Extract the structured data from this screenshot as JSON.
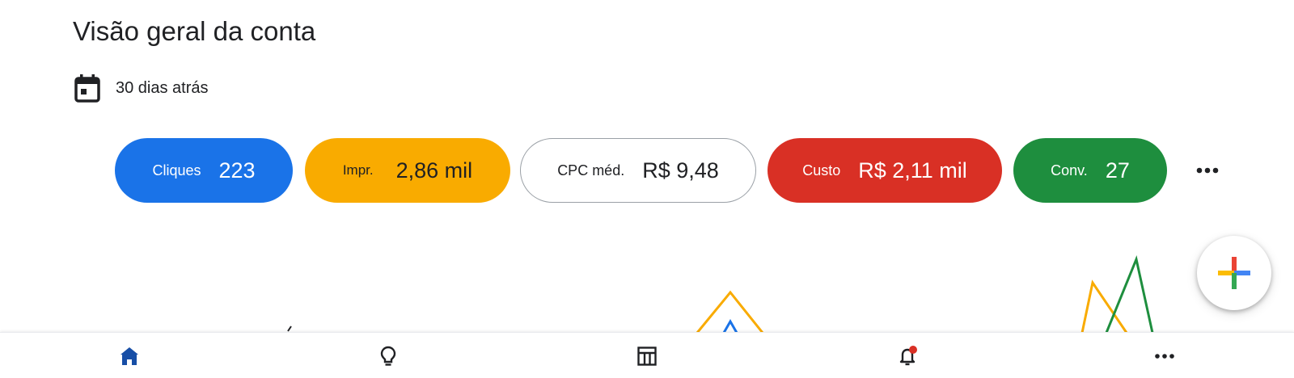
{
  "header": {
    "title": "Visão geral da conta"
  },
  "date_range": {
    "icon": "calendar-icon",
    "label": "30 dias atrás"
  },
  "metrics": [
    {
      "id": "clicks",
      "label": "Cliques",
      "value": "223",
      "color": "#1a73e8",
      "selected": true
    },
    {
      "id": "impressions",
      "label": "Impr.",
      "value": "2,86 mil",
      "color": "#f9ab00",
      "selected": true
    },
    {
      "id": "avg_cpc",
      "label": "CPC méd.",
      "value": "R$ 9,48",
      "color": "#ffffff",
      "selected": false
    },
    {
      "id": "cost",
      "label": "Custo",
      "value": "R$ 2,11 mil",
      "color": "#d93025",
      "selected": true
    },
    {
      "id": "conversions",
      "label": "Conv.",
      "value": "27",
      "color": "#1e8e3e",
      "selected": true
    }
  ],
  "more_metrics_icon": "more-horizontal-icon",
  "fab": {
    "icon": "plus-icon",
    "colors": [
      "#ea4335",
      "#4285f4",
      "#fbbc04",
      "#34a853"
    ]
  },
  "bottom_nav": [
    {
      "id": "home",
      "icon": "home-icon",
      "active": true
    },
    {
      "id": "ideas",
      "icon": "lightbulb-icon",
      "active": false
    },
    {
      "id": "campaigns",
      "icon": "table-icon",
      "active": false
    },
    {
      "id": "notifications",
      "icon": "bell-icon",
      "active": false,
      "has_badge": true
    },
    {
      "id": "more",
      "icon": "more-horizontal-icon",
      "active": false
    }
  ],
  "colors": {
    "accent": "#1a73e8",
    "nav_active": "#174ea6",
    "notification_badge": "#d93025"
  }
}
